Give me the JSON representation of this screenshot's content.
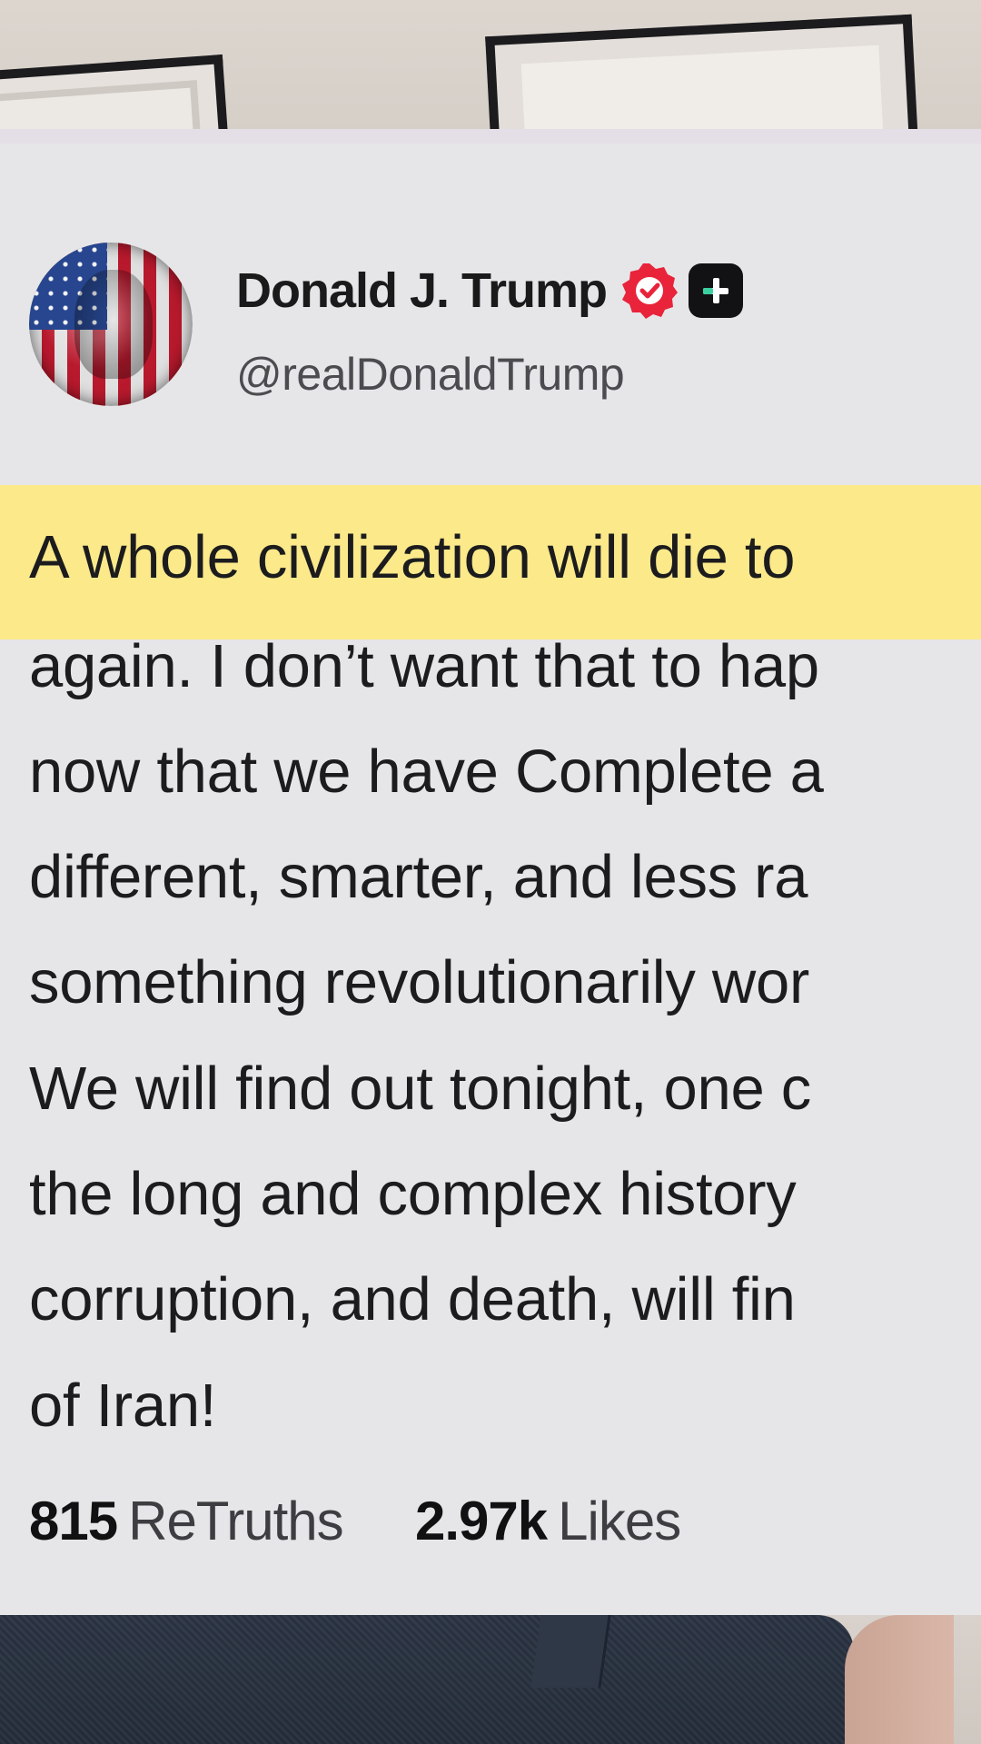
{
  "post": {
    "author": {
      "display_name": "Donald J. Trump",
      "handle": "@realDonaldTrump",
      "verified": true,
      "badge_icons": [
        "verified-check-icon",
        "truth-plus-icon"
      ]
    },
    "text_lines": [
      "A whole civilization will die to",
      "again. I don’t want that to hap",
      "now that we have Complete a",
      "different, smarter, and less ra",
      "something revolutionarily wor",
      "We will find out tonight, one c",
      "the long and complex history",
      "corruption, and death, will fin",
      "of Iran!"
    ],
    "highlighted_line_index": 0,
    "stats": {
      "retruths_count": "815",
      "retruths_label": "ReTruths",
      "likes_count": "2.97k",
      "likes_label": "Likes"
    }
  },
  "colors": {
    "card_background": "#e6e6e8",
    "highlight": "#fbe98a",
    "verified_badge": "#e8233a",
    "text": "#1c1c1e"
  }
}
